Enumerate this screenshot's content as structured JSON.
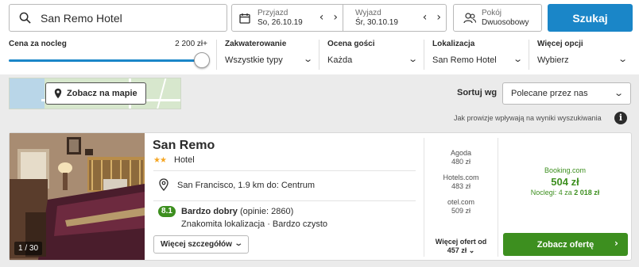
{
  "search": {
    "destination": "San Remo Hotel"
  },
  "dates": {
    "checkin_label": "Przyjazd",
    "checkin_value": "So, 26.10.19",
    "checkout_label": "Wyjazd",
    "checkout_value": "Śr, 30.10.19",
    "prev_arrow": "‹",
    "next_arrow": "›"
  },
  "guests": {
    "label": "Pokój",
    "value": "Dwuosobowy"
  },
  "search_button": "Szukaj",
  "filters": {
    "price_label": "Cena za nocleg",
    "price_max": "2 200 zł+",
    "price_slider_level": 1.0,
    "accommodation_label": "Zakwaterowanie",
    "accommodation_value": "Wszystkie typy",
    "rating_label": "Ocena gości",
    "rating_value": "Każda",
    "location_label": "Lokalizacja",
    "location_value": "San Remo Hotel",
    "more_label": "Więcej opcji",
    "more_value": "Wybierz",
    "chevron": "⌄"
  },
  "map_button": "Zobacz na mapie",
  "sort": {
    "label": "Sortuj wg",
    "value": "Polecane przez nas"
  },
  "commission_text": "Jak prowizje wpływają na wyniki wyszukiwania",
  "info_icon": "i",
  "hotel": {
    "name": "San Remo",
    "stars": "★★",
    "star_count": 2,
    "type": "Hotel",
    "location": "San Francisco, 1.9 km do: Centrum",
    "rating_score": "8.1",
    "rating_word": "Bardzo dobry",
    "rating_reviews": "(opinie: 2860)",
    "highlights": "Znakomita lokalizacja · Bardzo czysto",
    "more_details": "Więcej szczegółów",
    "photo_count": "1 / 30"
  },
  "offers": [
    {
      "provider": "Agoda",
      "price": "480 zł"
    },
    {
      "provider": "Hotels.com",
      "price": "483 zł"
    },
    {
      "provider": "otel.com",
      "price": "509 zł"
    }
  ],
  "more_offers_line1": "Więcej ofert od",
  "more_offers_line2": "457 zł",
  "best_offer": {
    "provider": "Booking.com",
    "price": "504 zł",
    "nights_prefix": "Noclegi: 4 za",
    "nights_total": "2 018 zł",
    "button": "Zobacz ofertę"
  },
  "colors": {
    "accent_blue": "#1a86c8",
    "deal_green": "#3d8f1f",
    "band_gray": "#ebebeb",
    "star_orange": "#f5a623"
  }
}
